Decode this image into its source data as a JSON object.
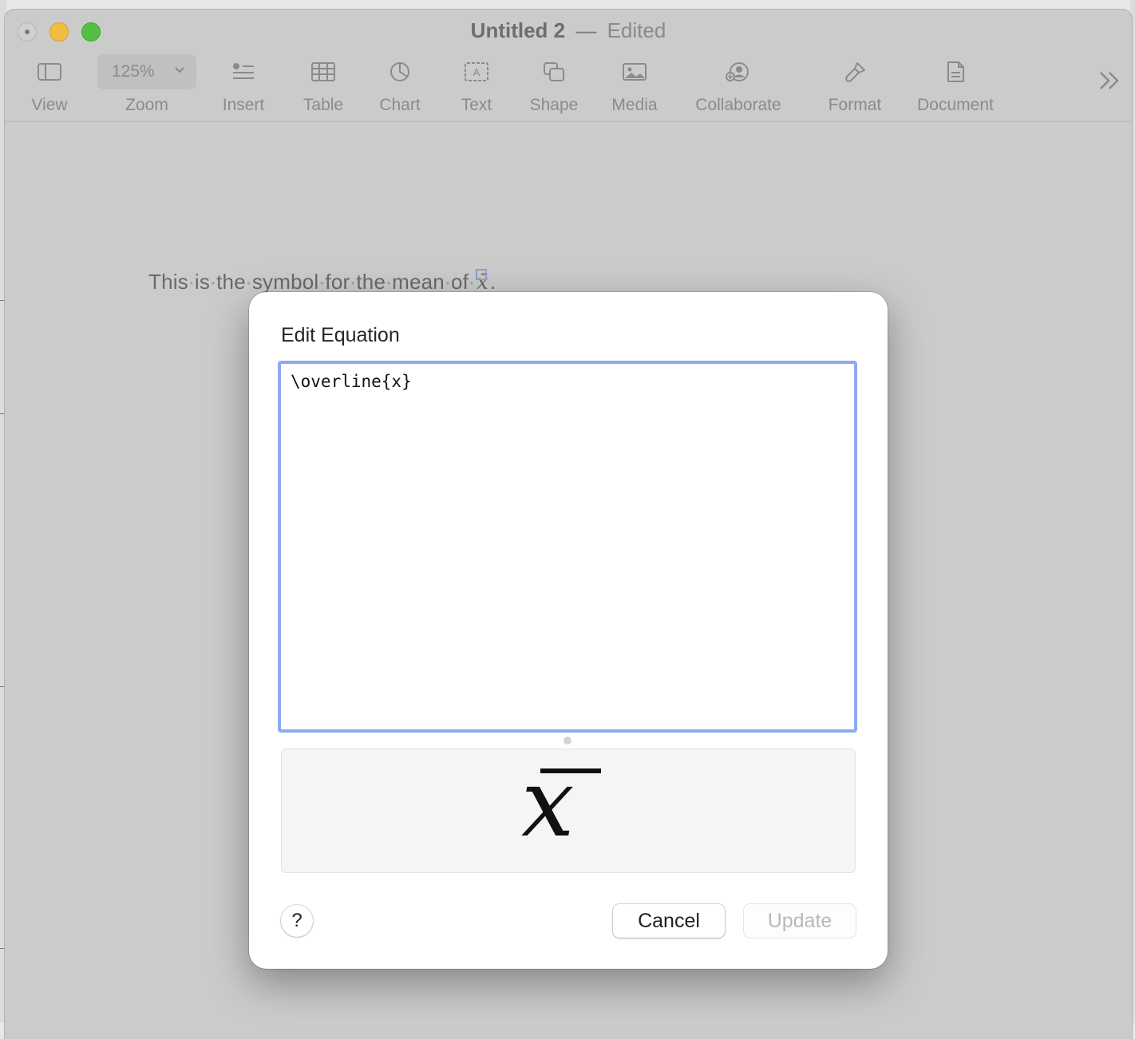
{
  "window": {
    "title": "Untitled 2",
    "separator": "—",
    "status": "Edited"
  },
  "toolbar": {
    "zoom_value": "125%",
    "items": [
      {
        "label": "View",
        "icon": "sidebar-icon"
      },
      {
        "label": "Zoom",
        "icon": "chevron-down-icon"
      },
      {
        "label": "Insert",
        "icon": "insert-list-icon"
      },
      {
        "label": "Table",
        "icon": "table-icon"
      },
      {
        "label": "Chart",
        "icon": "pie-chart-icon"
      },
      {
        "label": "Text",
        "icon": "text-box-icon"
      },
      {
        "label": "Shape",
        "icon": "shape-icon"
      },
      {
        "label": "Media",
        "icon": "photo-icon"
      },
      {
        "label": "Collaborate",
        "icon": "collaborate-icon"
      },
      {
        "label": "Format",
        "icon": "paintbrush-icon"
      },
      {
        "label": "Document",
        "icon": "document-icon"
      }
    ],
    "overflow_icon": "double-chevron-right-icon"
  },
  "document": {
    "words": [
      "This",
      "is",
      "the",
      "symbol",
      "for",
      "the",
      "mean",
      "of"
    ],
    "equation_glyph": "x̄",
    "trailing": "."
  },
  "dialog": {
    "title": "Edit Equation",
    "equation_source": "\\overline{x}",
    "preview_variable": "x",
    "help_label": "?",
    "cancel_label": "Cancel",
    "update_label": "Update"
  },
  "colors": {
    "focus_ring": "#8eaaf0",
    "traffic_min": "#f4bd41",
    "traffic_max": "#54c043"
  }
}
